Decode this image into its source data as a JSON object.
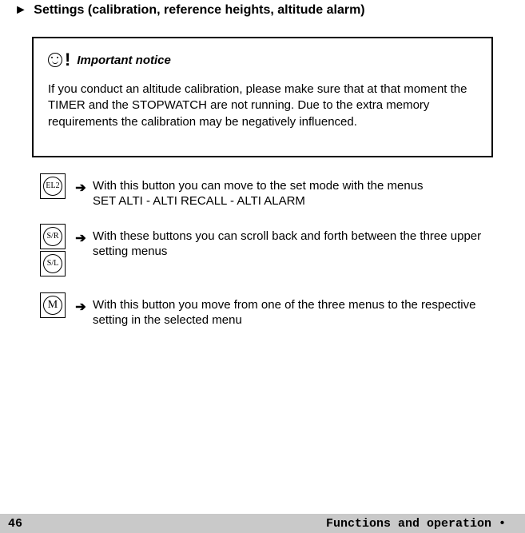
{
  "heading_arrow": "►",
  "heading_text": "Settings (calibration, reference heights, altitude alarm)",
  "notice": {
    "title": "Important notice",
    "body": "If you conduct an altitude calibration, please make sure that at that moment the TIMER and the STOPWATCH are not running. Due to the extra memory requirements the calibration may be negatively influenced."
  },
  "instructions": [
    {
      "buttons": [
        "EL2"
      ],
      "text_line1": "With this button you can move to the set mode with the menus",
      "text_line2": "SET ALTI   -    ALTI RECALL   -   ALTI ALARM"
    },
    {
      "buttons": [
        "S/R",
        "S/L"
      ],
      "text_line1": "With these buttons you can scroll back and forth between the three upper setting menus",
      "text_line2": ""
    },
    {
      "buttons": [
        "M"
      ],
      "text_line1": "With this button you move from one of the three menus to the respective setting in the selected menu",
      "text_line2": ""
    }
  ],
  "arrow_glyph": "➔",
  "footer": {
    "page": "46",
    "section": "Functions and operation •"
  }
}
